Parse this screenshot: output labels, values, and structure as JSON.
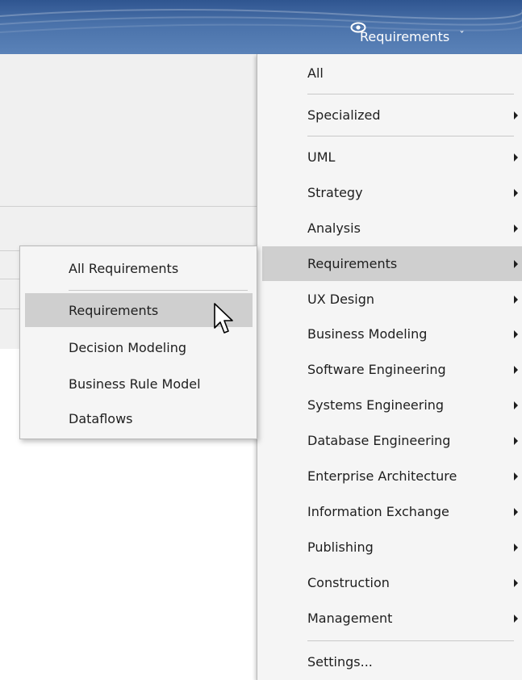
{
  "perspective_button": {
    "label": "Requirements"
  },
  "menu": {
    "items": [
      {
        "label": "All"
      },
      {
        "label": "Specialized"
      },
      {
        "label": "UML"
      },
      {
        "label": "Strategy"
      },
      {
        "label": "Analysis"
      },
      {
        "label": "Requirements"
      },
      {
        "label": "UX Design"
      },
      {
        "label": "Business Modeling"
      },
      {
        "label": "Software Engineering"
      },
      {
        "label": "Systems Engineering"
      },
      {
        "label": "Database Engineering"
      },
      {
        "label": "Enterprise Architecture"
      },
      {
        "label": "Information Exchange"
      },
      {
        "label": "Publishing"
      },
      {
        "label": "Construction"
      },
      {
        "label": "Management"
      },
      {
        "label": "Settings..."
      }
    ]
  },
  "submenu": {
    "items": [
      {
        "label": "All Requirements"
      },
      {
        "label": "Requirements"
      },
      {
        "label": "Decision Modeling"
      },
      {
        "label": "Business Rule Model"
      },
      {
        "label": "Dataflows"
      }
    ]
  },
  "colors": {
    "ribbon": "#3d6399",
    "highlight": "#cfcfcf",
    "menu_bg": "#f5f5f5"
  }
}
